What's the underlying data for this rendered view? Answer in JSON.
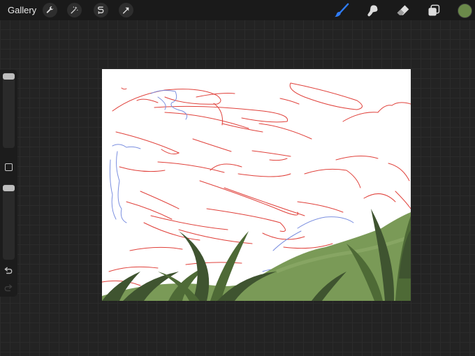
{
  "toolbar": {
    "gallery_label": "Gallery",
    "left_tools": [
      "wrench-icon",
      "magic-wand-icon",
      "selection-icon",
      "transform-arrow-icon"
    ],
    "right_tools": [
      "brush-icon",
      "smudge-icon",
      "eraser-icon",
      "layers-icon"
    ],
    "active_tool": "brush-icon",
    "active_tool_color": "#2f7cf6",
    "current_color": "#6b8a4a"
  },
  "sidebar": {
    "brush_size": 0.95,
    "opacity": 0.95,
    "controls": [
      "modify-button",
      "undo-icon",
      "redo-icon"
    ]
  },
  "canvas": {
    "sketch_colors": [
      "#e0403a",
      "#7b8fe0"
    ],
    "grass_colors": [
      "#7a9a57",
      "#3f5430",
      "#4e6a36"
    ]
  }
}
